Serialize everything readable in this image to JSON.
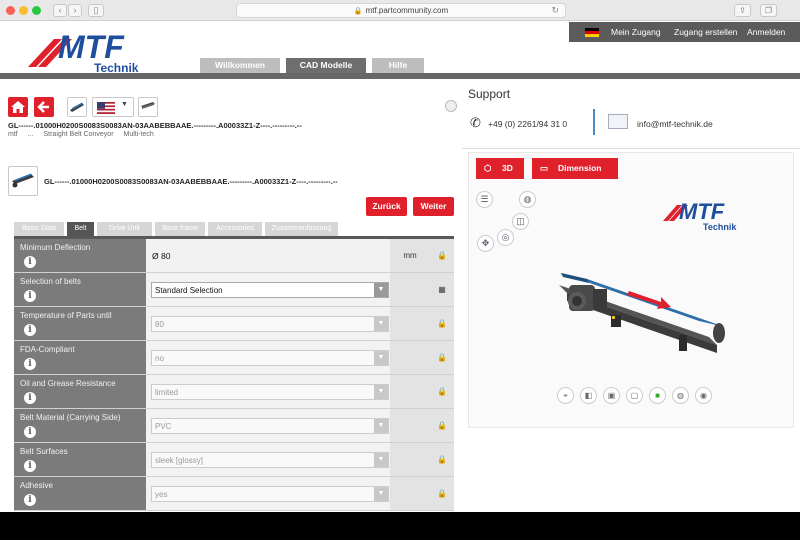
{
  "browser": {
    "url": "mtf.partcommunity.com",
    "lock_icon": "lock-icon",
    "reload_icon": "reload-icon"
  },
  "topbar": {
    "account": "Mein Zugang",
    "create_account": "Zugang erstellen",
    "login": "Anmelden"
  },
  "logo": {
    "brand": "MTF",
    "sub": "Technik"
  },
  "nav": {
    "tabs": [
      {
        "label": "Willkommen",
        "active": false
      },
      {
        "label": "CAD Modelle",
        "active": true
      },
      {
        "label": "Hilfe",
        "active": false
      }
    ]
  },
  "part": {
    "id": "GL------.01000H0200S0083S0083AN-03AABEBBAAE.---------.A00033Z1-Z----.---------.--",
    "id_detail": "GL------.01000H0200S0083S0083AN-03AABEBBAAE.---------.A00033Z1-Z----.---------.--",
    "breadcrumb": [
      "mtf",
      "...",
      "Straight Belt Conveyor",
      "Multi-tech"
    ],
    "back_label": "Zurück",
    "next_label": "Weiter"
  },
  "tabs": [
    {
      "label": "Basic Data",
      "active": false
    },
    {
      "label": "Belt",
      "active": true
    },
    {
      "label": "Drive Unit",
      "active": false
    },
    {
      "label": "Base frame",
      "active": false
    },
    {
      "label": "Accessories",
      "active": false
    },
    {
      "label": "Zusammenfassung",
      "active": false
    }
  ],
  "rows": [
    {
      "label": "Minimum Deflection",
      "type": "text",
      "value": "Ø 80",
      "unit": "mm",
      "lock": true
    },
    {
      "label": "Selection of belts",
      "type": "select",
      "value": "Standard Selection",
      "enabled": true,
      "unit": "",
      "lock": false
    },
    {
      "label": "Temperature of Parts until",
      "type": "select",
      "value": "80",
      "enabled": false,
      "unit": "",
      "lock": true
    },
    {
      "label": "FDA-Compliant",
      "type": "select",
      "value": "no",
      "enabled": false,
      "unit": "",
      "lock": true
    },
    {
      "label": "Oil and Grease Resistance",
      "type": "select",
      "value": "limited",
      "enabled": false,
      "unit": "",
      "lock": true
    },
    {
      "label": "Belt Material (Carrying Side)",
      "type": "select",
      "value": "PVC",
      "enabled": false,
      "unit": "",
      "lock": true
    },
    {
      "label": "Belt Surfaces",
      "type": "select",
      "value": "sleek [glossy]",
      "enabled": false,
      "unit": "",
      "lock": true
    },
    {
      "label": "Adhesive",
      "type": "select",
      "value": "yes",
      "enabled": false,
      "unit": "",
      "lock": true
    }
  ],
  "support": {
    "title": "Support",
    "phone": "+49 (0) 2261/94 31 0",
    "email": "info@mtf-technik.de"
  },
  "viewer": {
    "btn_3d": "3D",
    "btn_dimension": "Dimension"
  },
  "colors": {
    "accent_red": "#e0202b",
    "brand_blue": "#1f4e9e",
    "dark_grey": "#676767",
    "label_grey": "#7b7b7b",
    "belt_blue": "#2f6fa8"
  }
}
